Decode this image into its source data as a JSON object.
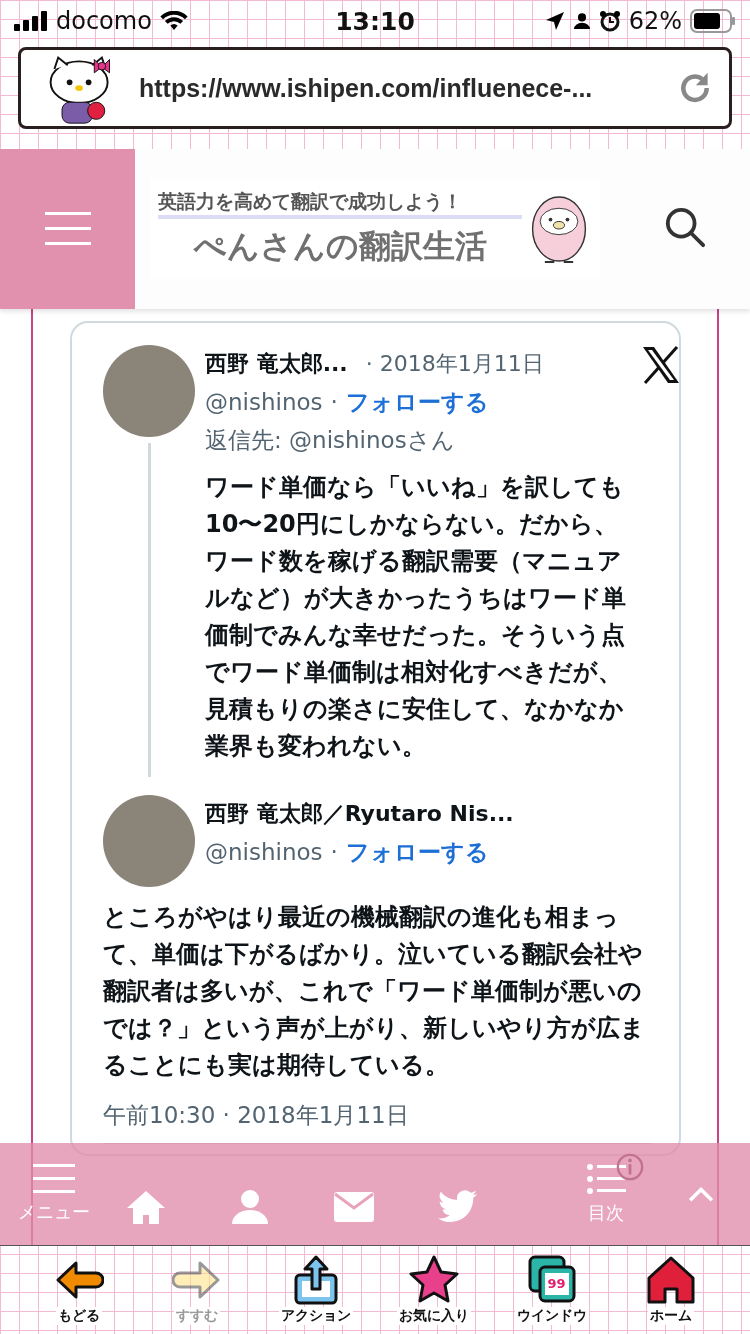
{
  "status_bar": {
    "carrier": "docomo",
    "time": "13:10",
    "battery": "62%"
  },
  "address_bar": {
    "url": "https://www.ishipen.com/influenece-..."
  },
  "site_header": {
    "tagline": "英語力を高めて翻訳で成功しよう！",
    "title": "ぺんさんの翻訳生活"
  },
  "tweets": [
    {
      "kind": "reply",
      "name": "西野 竜太郎...",
      "date": "· 2018年1月11日",
      "handle": "@nishinos",
      "separator": "·",
      "follow": "フォローする",
      "reply_to": "返信先: @nishinosさん",
      "text": "ワード単価なら「いいね」を訳しても10〜20円にしかならない。だから、ワード数を稼げる翻訳需要（マニュアルなど）が大きかったうちはワード単価制でみんな幸せだった。そういう点でワード単価制は相対化すべきだが、見積もりの楽さに安住して、なかなか業界も変われない。"
    },
    {
      "kind": "main",
      "name": "西野 竜太郎／Ryutaro Nis...",
      "handle": "@nishinos",
      "separator": "·",
      "follow": "フォローする",
      "text": "ところがやはり最近の機械翻訳の進化も相まって、単価は下がるばかり。泣いている翻訳会社や翻訳者は多いが、これで「ワード単価制が悪いのでは？」という声が上がり、新しいやり方が広まることにも実は期待している。",
      "timestamp": "午前10:30 · 2018年1月11日"
    }
  ],
  "floating_nav": [
    {
      "kind": "menu",
      "label": "メニュー"
    },
    {
      "kind": "home"
    },
    {
      "kind": "user"
    },
    {
      "kind": "mail"
    },
    {
      "kind": "bird"
    },
    {
      "kind": "toc",
      "label": "目次"
    },
    {
      "kind": "up"
    }
  ],
  "toolbar": [
    {
      "kind": "back",
      "label": "もどる",
      "disabled": false
    },
    {
      "kind": "forward",
      "label": "すすむ",
      "disabled": true
    },
    {
      "kind": "share",
      "label": "アクション",
      "disabled": false
    },
    {
      "kind": "star",
      "label": "お気に入り",
      "disabled": false
    },
    {
      "kind": "windows",
      "label": "ウインドウ",
      "badge": "99",
      "disabled": false
    },
    {
      "kind": "home",
      "label": "ホーム",
      "disabled": false
    }
  ]
}
